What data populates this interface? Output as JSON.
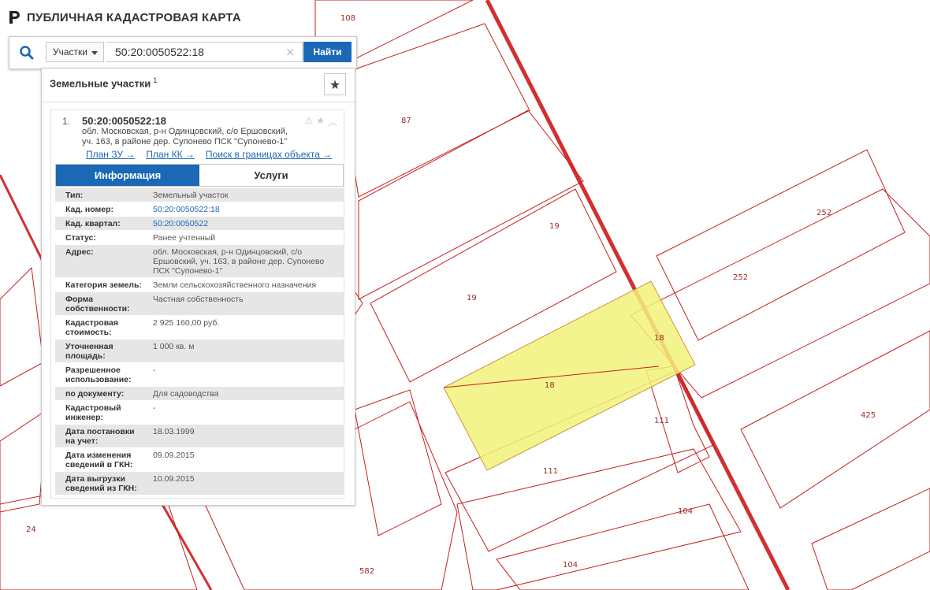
{
  "app": {
    "title": "ПУБЛИЧНАЯ КАДАСТРОВАЯ КАРТА"
  },
  "search": {
    "type_label": "Участки",
    "query": "50:20:0050522:18",
    "clear_glyph": "×",
    "button_label": "Найти"
  },
  "panel": {
    "title": "Земельные участки",
    "count": "1",
    "favorite_glyph": "★"
  },
  "result": {
    "index": "1.",
    "cad_number": "50:20:0050522:18",
    "address": "обл. Московская, р-н Одинцовский, с/о Ершовский, уч. 163, в районе дер. Супонево ПСК \"Супонево-1\"",
    "links": [
      "План ЗУ →",
      "План КК →",
      "Поиск в границах объекта →"
    ],
    "tabs": {
      "info": "Информация",
      "services": "Услуги"
    },
    "rows": [
      {
        "key": "Тип:",
        "value": "Земельный участок"
      },
      {
        "key": "Кад. номер:",
        "value": "50:20:0050522:18",
        "link": true
      },
      {
        "key": "Кад. квартал:",
        "value": "50:20:0050522",
        "link": true
      },
      {
        "key": "Статус:",
        "value": "Ранее учтенный"
      },
      {
        "key": "Адрес:",
        "value": "обл. Московская, р-н Одинцовский, с/о Ершовский, уч. 163, в районе дер. Супонево ПСК \"Супонево-1\""
      },
      {
        "key": "Категория земель:",
        "value": "Земли сельскохозяйственного назначения"
      },
      {
        "key": "Форма собственности:",
        "value": "Частная собственность"
      },
      {
        "key": "Кадастровая стоимость:",
        "value": "2 925 160,00 руб."
      },
      {
        "key": "Уточненная площадь:",
        "value": "1 000 кв. м"
      },
      {
        "key": "Разрешенное использование:",
        "value": "-"
      },
      {
        "key": "по документу:",
        "value": "Для садоводства"
      },
      {
        "key": "Кадастровый инженер:",
        "value": "-"
      },
      {
        "key": "Дата постановки на учет:",
        "value": "18.03.1999"
      },
      {
        "key": "Дата изменения сведений в ГКН:",
        "value": "09.09.2015"
      },
      {
        "key": "Дата выгрузки сведений из ГКН:",
        "value": "10.09.2015"
      }
    ]
  },
  "map": {
    "selected_fill": "#f2f27a",
    "parcel_stroke": "#c81e1e",
    "labels": [
      "108",
      "87",
      "19",
      "19",
      "252",
      "252",
      "18",
      "18",
      "111",
      "111",
      "425",
      "104",
      "104",
      "582",
      "24"
    ]
  }
}
